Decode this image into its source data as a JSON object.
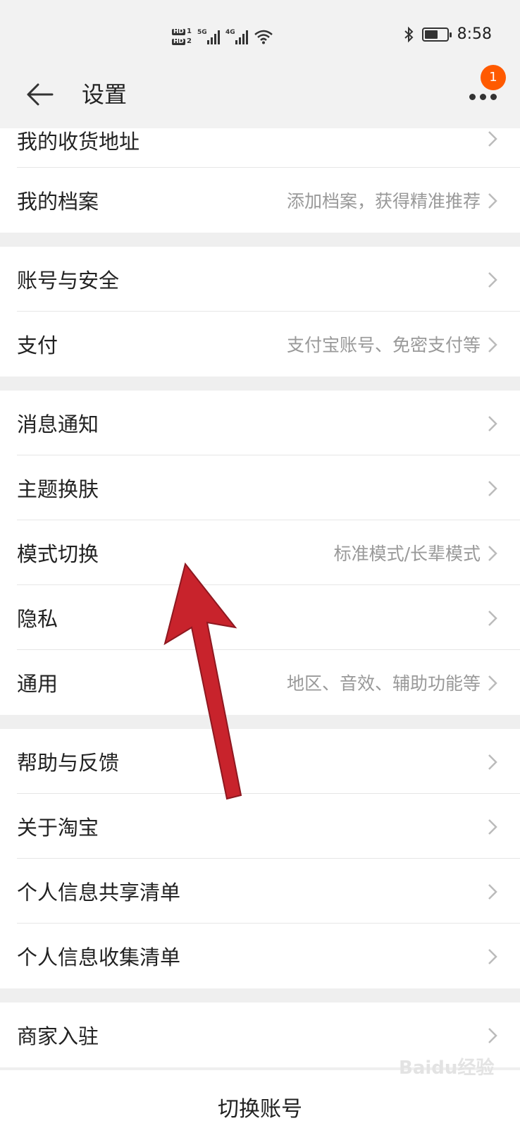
{
  "status_bar": {
    "hd1": "HD",
    "hd1_sim": "1",
    "hd2": "HD",
    "hd2_sim": "2",
    "net1": "5G",
    "net2": "4G",
    "time": "8:58"
  },
  "nav": {
    "title": "设置",
    "notification_count": "1"
  },
  "groups": [
    {
      "items": [
        {
          "label": "我的收货地址",
          "hint": ""
        },
        {
          "label": "我的档案",
          "hint": "添加档案，获得精准推荐"
        }
      ]
    },
    {
      "items": [
        {
          "label": "账号与安全",
          "hint": ""
        },
        {
          "label": "支付",
          "hint": "支付宝账号、免密支付等"
        }
      ]
    },
    {
      "items": [
        {
          "label": "消息通知",
          "hint": ""
        },
        {
          "label": "主题换肤",
          "hint": ""
        },
        {
          "label": "模式切换",
          "hint": "标准模式/长辈模式"
        },
        {
          "label": "隐私",
          "hint": ""
        },
        {
          "label": "通用",
          "hint": "地区、音效、辅助功能等"
        }
      ]
    },
    {
      "items": [
        {
          "label": "帮助与反馈",
          "hint": ""
        },
        {
          "label": "关于淘宝",
          "hint": ""
        },
        {
          "label": "个人信息共享清单",
          "hint": ""
        },
        {
          "label": "个人信息收集清单",
          "hint": ""
        }
      ]
    },
    {
      "items": [
        {
          "label": "商家入驻",
          "hint": ""
        }
      ]
    }
  ],
  "bottom": {
    "switch_account": "切换账号"
  },
  "watermark": "Baidu经验",
  "colors": {
    "badge": "#ff5a00",
    "annotation_arrow": "#c8232c"
  }
}
